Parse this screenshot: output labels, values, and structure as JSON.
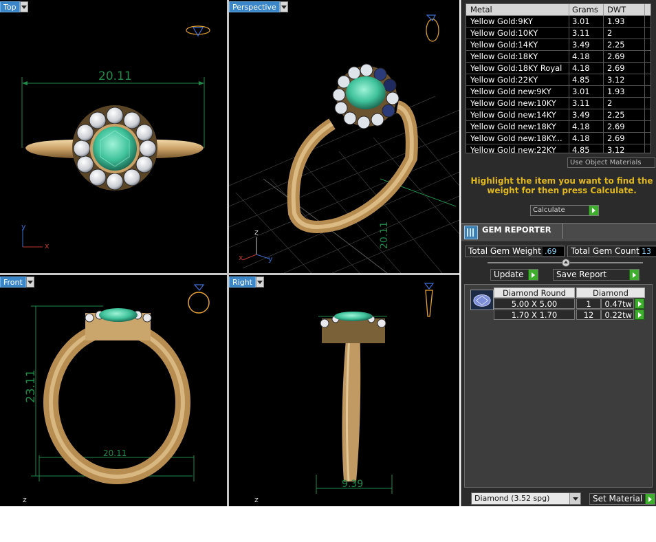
{
  "viewports": {
    "top": {
      "label": "Top",
      "dimension": "20.11"
    },
    "perspective": {
      "label": "Perspective",
      "dimension": "20.11"
    },
    "front": {
      "label": "Front",
      "dimension": "23.11",
      "dimension2": "20.11"
    },
    "right": {
      "label": "Right",
      "dimension": "9.39"
    }
  },
  "axes": {
    "x": "x",
    "y": "y",
    "z": "z"
  },
  "metal_table": {
    "headers": [
      "Metal",
      "Grams",
      "DWT"
    ],
    "rows": [
      [
        "Yellow Gold:9KY",
        "3.01",
        "1.93"
      ],
      [
        "Yellow Gold:10KY",
        "3.11",
        "2"
      ],
      [
        "Yellow Gold:14KY",
        "3.49",
        "2.25"
      ],
      [
        "Yellow Gold:18KY",
        "4.18",
        "2.69"
      ],
      [
        "Yellow Gold:18KY Royal",
        "4.18",
        "2.69"
      ],
      [
        "Yellow Gold:22KY",
        "4.85",
        "3.12"
      ],
      [
        "Yellow Gold new:9KY",
        "3.01",
        "1.93"
      ],
      [
        "Yellow Gold new:10KY",
        "3.11",
        "2"
      ],
      [
        "Yellow Gold new:14KY",
        "3.49",
        "2.25"
      ],
      [
        "Yellow Gold new:18KY",
        "4.18",
        "2.69"
      ],
      [
        "Yellow Gold new:18KY...",
        "4.18",
        "2.69"
      ],
      [
        "Yellow Gold new:22KY",
        "4.85",
        "3.12"
      ]
    ]
  },
  "use_object_materials": "Use Object Materials",
  "hint": "Highlight the item you want to find the weight for then press Calculate.",
  "calculate_label": "Calculate",
  "gem_reporter": {
    "title": "GEM REPORTER",
    "total_weight_label": "Total Gem Weight",
    "total_weight_value": ".69",
    "total_count_label": "Total Gem Count",
    "total_count_value": "13",
    "update_label": "Update",
    "save_report_label": "Save Report",
    "col_cut": "Diamond Round",
    "col_material": "Diamond",
    "gems": [
      {
        "size": "5.00 X 5.00",
        "count": "1",
        "weight": "0.47tw"
      },
      {
        "size": "1.70 X 1.70",
        "count": "12",
        "weight": "0.22tw"
      }
    ]
  },
  "material_select": "Diamond     (3.52 spg)",
  "set_material_label": "Set Material",
  "colors": {
    "gold": "#d9b47a",
    "gem": "#4fd0a8",
    "dimension": "#1f8a4a",
    "hint": "#e0b820",
    "accent": "#3a86c8"
  }
}
